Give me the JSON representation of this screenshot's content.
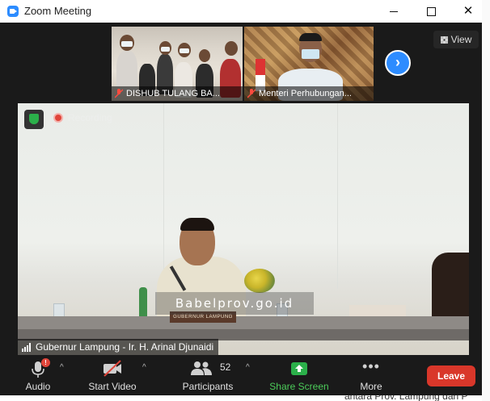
{
  "window": {
    "title": "Zoom Meeting"
  },
  "thumbnails": [
    {
      "name": "DISHUB TULANG BA..."
    },
    {
      "name": "Menteri Perhubungan..."
    }
  ],
  "view_button": {
    "label": "View"
  },
  "main_video": {
    "recording_label": "Recording",
    "speaker_name": "Gubernur Lampung - Ir. H. Arinal Djunaidi",
    "watermark": "Babelprov.go.id",
    "nameplate": "GUBERNUR LAMPUNG"
  },
  "toolbar": {
    "audio_label": "Audio",
    "audio_badge": "!",
    "start_video_label": "Start Video",
    "participants_label": "Participants",
    "participants_count": "52",
    "share_screen_label": "Share Screen",
    "more_label": "More",
    "leave_label": "Leave"
  },
  "colors": {
    "zoom_blue": "#2d8cff",
    "share_green": "#2bb04a",
    "leave_red": "#d9372a"
  },
  "background_document": {
    "bottom_text": "antara Prov. Lampung dan P"
  }
}
